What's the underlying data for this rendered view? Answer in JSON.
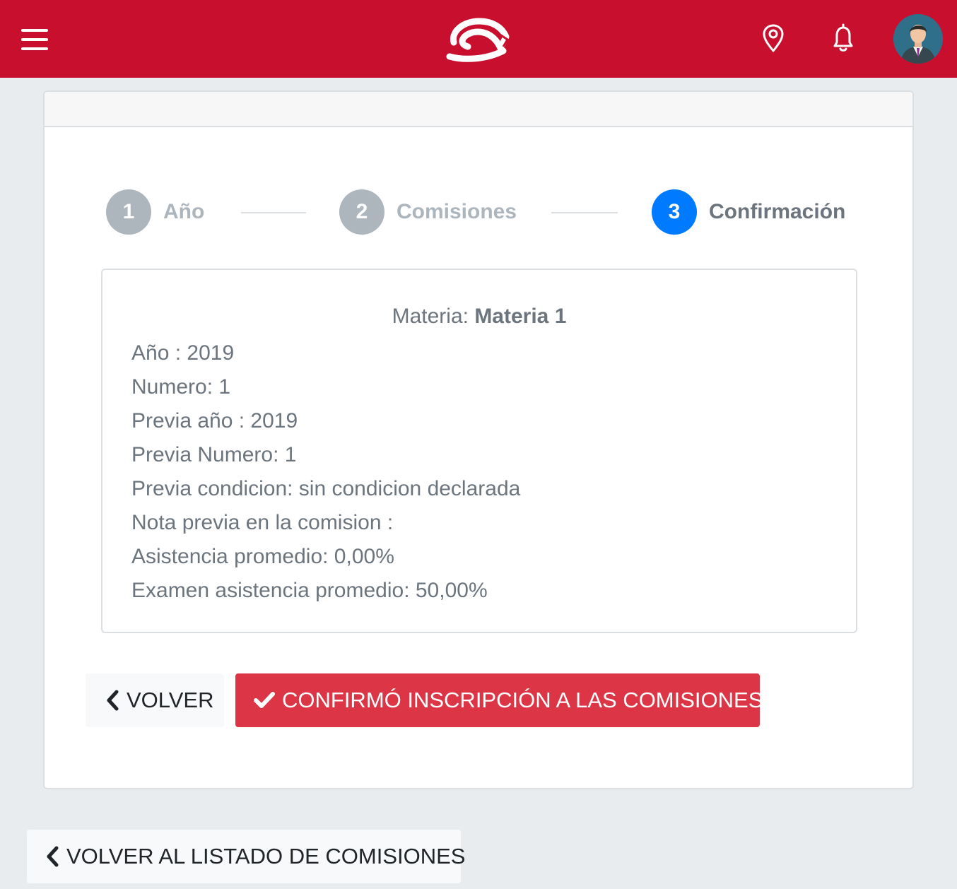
{
  "header": {
    "menu_icon": "hamburger-menu-icon",
    "logo_icon": "brand-logo",
    "location_icon": "map-pin-icon",
    "notification_icon": "bell-icon",
    "avatar": "user-avatar"
  },
  "stepper": {
    "steps": [
      {
        "number": "1",
        "label": "Año",
        "active": false
      },
      {
        "number": "2",
        "label": "Comisiones",
        "active": false
      },
      {
        "number": "3",
        "label": "Confirmación",
        "active": true
      }
    ]
  },
  "detail": {
    "materia_label": "Materia: ",
    "materia_value": "Materia 1",
    "lines": [
      "Año : 2019",
      "Numero: 1",
      "Previa año : 2019",
      "Previa Numero: 1",
      "Previa condicion: sin condicion declarada",
      "Nota previa en la comision :",
      "Asistencia promedio: 0,00%",
      "Examen asistencia promedio: 50,00%"
    ]
  },
  "actions": {
    "back_label": "VOLVER",
    "confirm_label": "CONFIRMÓ INSCRIPCIÓN A LAS COMISIONES",
    "back_to_list_label": "VOLVER AL LISTADO DE COMISIONES"
  },
  "colors": {
    "brand": "#c8102e",
    "active_step": "#007bff",
    "danger": "#dc3545"
  }
}
